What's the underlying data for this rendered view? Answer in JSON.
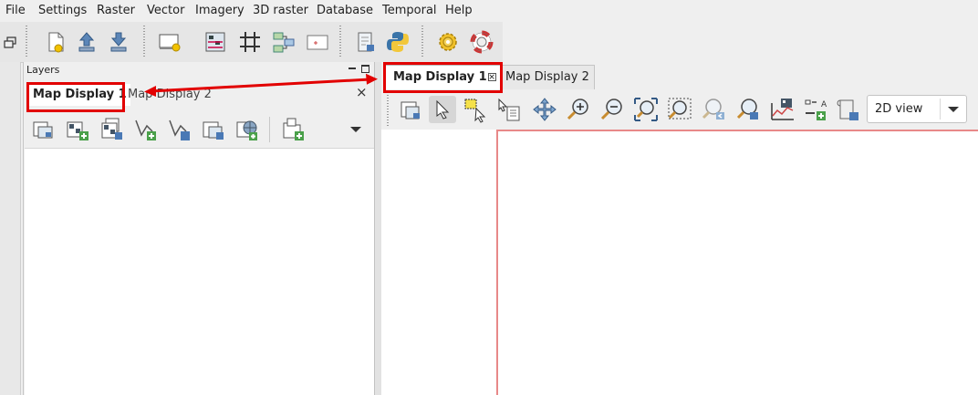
{
  "menubar": {
    "items": [
      "File",
      "Settings",
      "Raster",
      "Vector",
      "Imagery",
      "3D raster",
      "Database",
      "Temporal",
      "Help"
    ]
  },
  "toolbar": {
    "buttons": [
      "new-workspace-icon",
      "load-workspace-icon",
      "save-workspace-icon",
      "new-map-display-icon",
      "georectifier-icon",
      "grid-icon",
      "graphical-modeler-icon",
      "cartographic-composer-icon",
      "script-file-icon",
      "python-icon",
      "settings-gear-icon",
      "help-lifebuoy-icon"
    ]
  },
  "layers_panel": {
    "title": "Layers",
    "tabs": [
      {
        "label": "Map Display 1",
        "active": true
      },
      {
        "label": "Map Display 2",
        "active": false
      }
    ],
    "close_glyph": "×",
    "tools": [
      "add-layer-icon",
      "add-raster-icon",
      "add-multiple-rasters-icon",
      "add-vector-icon",
      "add-multiple-vectors-icon",
      "add-overlay-icon",
      "add-web-service-icon",
      "add-group-icon"
    ]
  },
  "map_display": {
    "tabs": [
      {
        "label": "Map Display 1",
        "active": true
      },
      {
        "label": "Map Display 2",
        "active": false
      }
    ],
    "tools": [
      "display-map-icon",
      "pointer-icon",
      "select-features-icon",
      "query-icon",
      "pan-icon",
      "zoom-in-icon",
      "zoom-out-icon",
      "zoom-extent-icon",
      "zoom-region-icon",
      "zoom-back-icon",
      "zoom-menu-icon",
      "profile-icon",
      "decoration-icon",
      "save-image-icon"
    ],
    "view_mode": "2D view"
  },
  "annotations": {
    "highlight_color": "#e20000",
    "highlighted": [
      "Map Display 1"
    ]
  }
}
